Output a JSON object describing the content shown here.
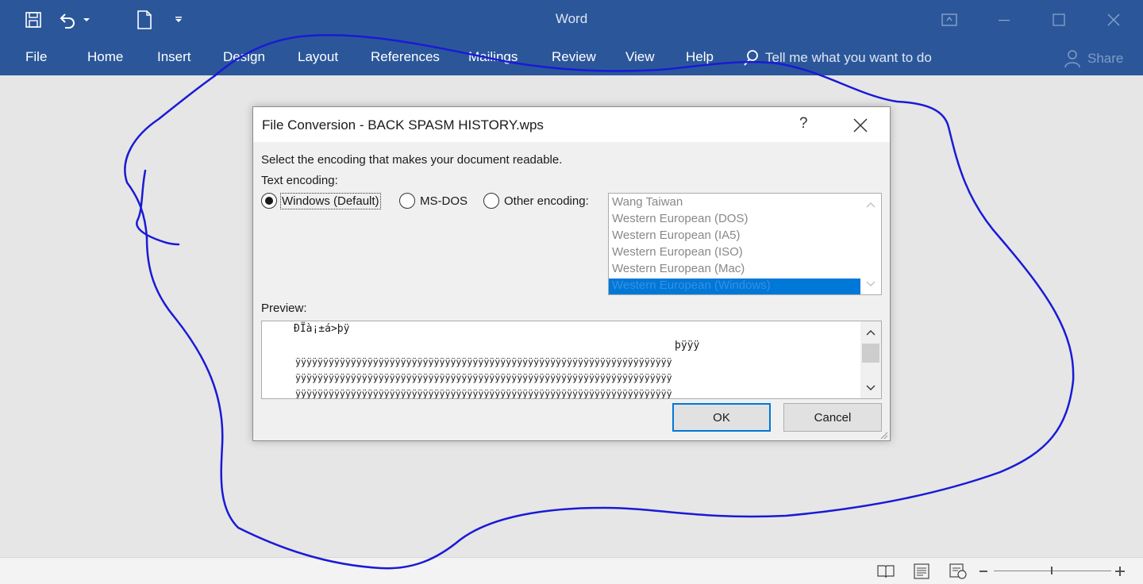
{
  "app": {
    "title": "Word"
  },
  "ribbon": {
    "tabs": [
      "File",
      "Home",
      "Insert",
      "Design",
      "Layout",
      "References",
      "Mailings",
      "Review",
      "View",
      "Help"
    ],
    "tell_me": "Tell me what you want to do",
    "share": "Share"
  },
  "dialog": {
    "title": "File Conversion - BACK SPASM HISTORY.wps",
    "help": "?",
    "instruction": "Select the encoding that makes your document readable.",
    "text_encoding_label": "Text encoding:",
    "options": [
      {
        "label": "Windows (Default)",
        "checked": true
      },
      {
        "label": "MS-DOS",
        "checked": false
      },
      {
        "label": "Other encoding:",
        "checked": false
      }
    ],
    "encodings": [
      "Wang Taiwan",
      "Western European (DOS)",
      "Western European (IA5)",
      "Western European (ISO)",
      "Western European (Mac)",
      "Western European (Windows)"
    ],
    "selected_encoding": "Western European (Windows)",
    "preview_label": "Preview:",
    "preview_lines": [
      "ÐÏà¡±á>þÿ",
      "þÿÿÿ",
      "ÿÿÿÿÿÿÿÿÿÿÿÿÿÿÿÿÿÿÿÿÿÿÿÿÿÿÿÿÿÿÿÿÿÿÿÿÿÿÿÿÿÿÿÿÿÿÿÿÿÿÿÿÿÿÿÿÿÿÿÿÿÿÿÿÿÿÿÿ",
      "ÿÿÿÿÿÿÿÿÿÿÿÿÿÿÿÿÿÿÿÿÿÿÿÿÿÿÿÿÿÿÿÿÿÿÿÿÿÿÿÿÿÿÿÿÿÿÿÿÿÿÿÿÿÿÿÿÿÿÿÿÿÿÿÿÿÿÿÿ",
      "ÿÿÿÿÿÿÿÿÿÿÿÿÿÿÿÿÿÿÿÿÿÿÿÿÿÿÿÿÿÿÿÿÿÿÿÿÿÿÿÿÿÿÿÿÿÿÿÿÿÿÿÿÿÿÿÿÿÿÿÿÿÿÿÿÿÿÿÿ"
    ],
    "ok_label": "OK",
    "cancel_label": "Cancel"
  },
  "icons": {
    "qat": [
      "save-icon",
      "undo-icon",
      "new-document-icon",
      "customize-icon"
    ],
    "window": [
      "ribbon-display-icon",
      "minimize-icon",
      "maximize-icon",
      "close-icon"
    ],
    "status": [
      "read-mode-icon",
      "print-layout-icon",
      "web-layout-icon",
      "zoom-out-icon",
      "zoom-in-icon"
    ]
  },
  "colors": {
    "accent": "#2b579a",
    "selection": "#0078d7",
    "ink": "#1a1ad6"
  }
}
